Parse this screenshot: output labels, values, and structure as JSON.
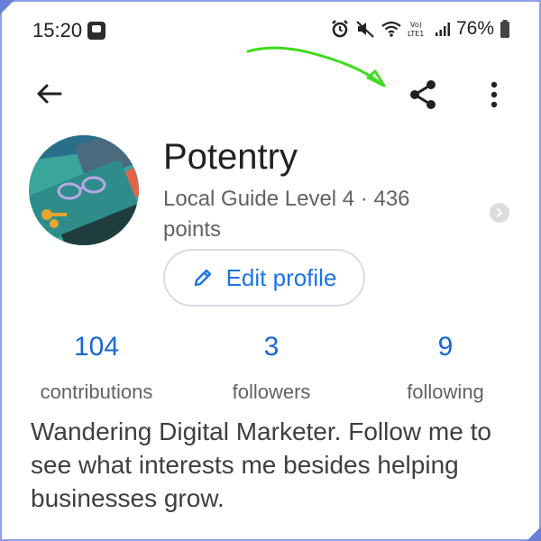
{
  "status_bar": {
    "time": "15:20",
    "battery": "76%",
    "icons": [
      "notification-icon",
      "alarm-icon",
      "mute-icon",
      "wifi-icon",
      "volte-icon",
      "signal-icon",
      "battery-icon"
    ]
  },
  "app_bar": {
    "back_icon": "arrow-left-icon",
    "share_icon": "share-icon",
    "more_icon": "more-vert-icon"
  },
  "profile": {
    "name": "Potentry",
    "guide_level": "Local Guide Level 4 · 436 points",
    "edit_button_label": "Edit profile"
  },
  "stats": [
    {
      "value": "104",
      "label": "contributions"
    },
    {
      "value": "3",
      "label": "followers"
    },
    {
      "value": "9",
      "label": "following"
    }
  ],
  "bio": "Wandering Digital Marketer. Follow me to see what interests me besides helping businesses grow.",
  "colors": {
    "accent": "#1a73e8",
    "stat_value": "#1967d2",
    "annotation": "#3ddc1e",
    "frame": "#8fa0e4"
  }
}
